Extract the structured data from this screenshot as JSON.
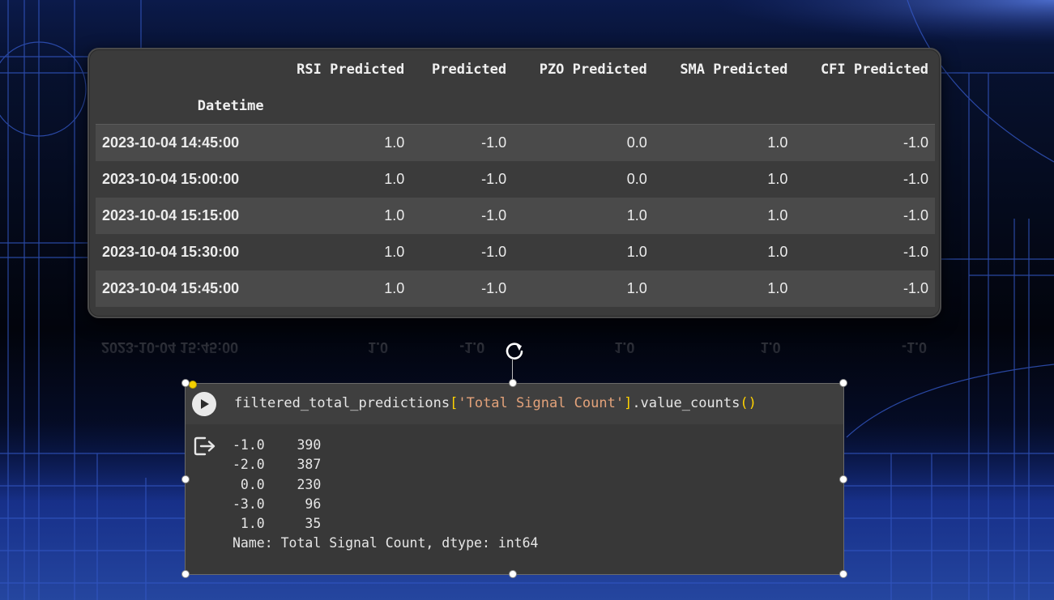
{
  "dataframe": {
    "index_name": "Datetime",
    "columns": [
      "RSI Predicted",
      "Predicted",
      "PZO Predicted",
      "SMA Predicted",
      "CFI Predicted"
    ],
    "rows": [
      {
        "index": "2023-10-04 14:45:00",
        "values": [
          "1.0",
          "-1.0",
          "0.0",
          "1.0",
          "-1.0"
        ]
      },
      {
        "index": "2023-10-04 15:00:00",
        "values": [
          "1.0",
          "-1.0",
          "0.0",
          "1.0",
          "-1.0"
        ]
      },
      {
        "index": "2023-10-04 15:15:00",
        "values": [
          "1.0",
          "-1.0",
          "1.0",
          "1.0",
          "-1.0"
        ]
      },
      {
        "index": "2023-10-04 15:30:00",
        "values": [
          "1.0",
          "-1.0",
          "1.0",
          "1.0",
          "-1.0"
        ]
      },
      {
        "index": "2023-10-04 15:45:00",
        "values": [
          "1.0",
          "-1.0",
          "1.0",
          "1.0",
          "-1.0"
        ]
      }
    ]
  },
  "code_cell": {
    "code_prefix": "filtered_total_predictions",
    "code_open_bracket": "[",
    "code_string": "'Total Signal Count'",
    "code_close_bracket": "]",
    "code_method": ".value_counts",
    "code_parens": "()",
    "output_lines": [
      "-1.0    390",
      "-2.0    387",
      " 0.0    230",
      "-3.0     96",
      " 1.0     35",
      "Name: Total Signal Count, dtype: int64"
    ]
  },
  "icons": {
    "run": "play-icon",
    "output": "output-redirect-icon",
    "rotate": "rotate-icon"
  },
  "colors": {
    "bracket": "#ffd200",
    "string": "#e3a27a",
    "background_grid": "#2a4aa8"
  }
}
